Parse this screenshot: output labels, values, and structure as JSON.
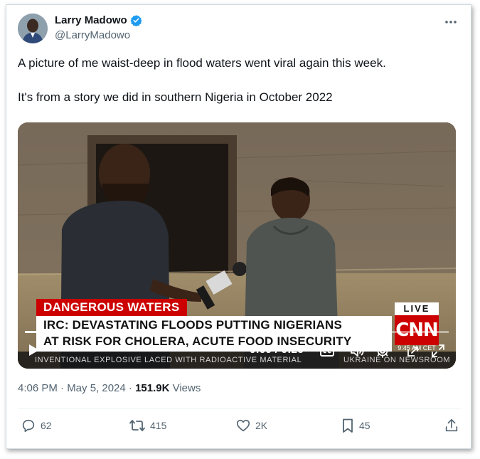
{
  "author": {
    "display_name": "Larry Madowo",
    "handle": "@LarryMadowo",
    "verified_color": "#1d9bf0"
  },
  "tweet": {
    "line1": "A picture of me waist-deep in flood waters went viral again this week.",
    "line2": "It's from a story we did in southern Nigeria in October 2022"
  },
  "video": {
    "banner": "DANGEROUS WATERS",
    "headline_line1": "IRC: DEVASTATING FLOODS PUTTING NIGERIANS",
    "headline_line2": "AT RISK FOR CHOLERA, ACUTE FOOD INSECURITY",
    "live_label": "LIVE",
    "network_logo": "CNN",
    "network_time": "9:45 AM CET",
    "ticker_text": "INVENTIONAL EXPLOSIVE LACED WITH RADIOACTIVE MATERIAL",
    "ticker_extra": "UKRAINE ON NEWSROOM",
    "time_current": "0:09",
    "time_total": "0:26",
    "progress_fraction": 0.35
  },
  "meta": {
    "timestamp": "4:06 PM · May 5, 2024 · ",
    "views_count": "151.9K",
    "views_label": " Views"
  },
  "actions": {
    "replies": "62",
    "reposts": "415",
    "likes": "2K",
    "bookmarks": "45"
  },
  "icons": {
    "more": "more-icon",
    "reply": "reply-icon",
    "repost": "repost-icon",
    "like": "heart-icon",
    "bookmark": "bookmark-icon",
    "share": "share-icon",
    "play": "play-icon",
    "captions": "captions-icon",
    "volume": "volume-icon",
    "settings": "gear-icon",
    "pip": "picture-in-picture-icon",
    "fullscreen": "fullscreen-icon"
  },
  "colors": {
    "accent": "#1d9bf0",
    "cnn_red": "#cc0000",
    "muted_text": "#536471"
  }
}
